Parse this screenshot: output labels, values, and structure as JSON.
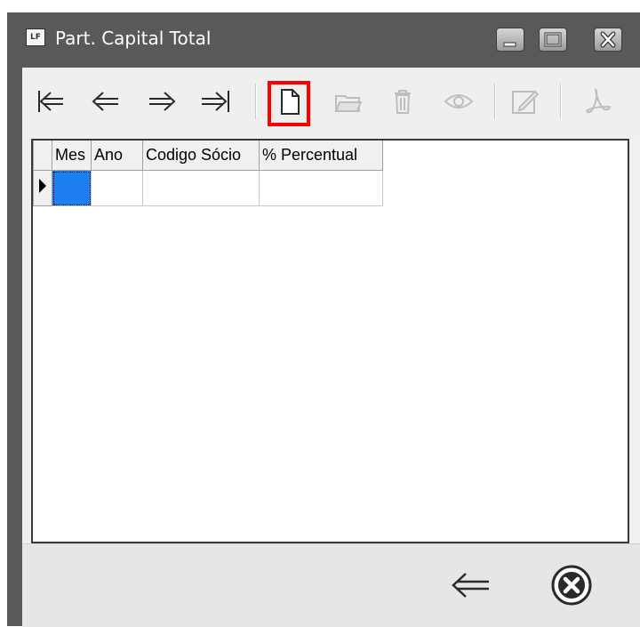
{
  "window": {
    "app_icon_text": "LF",
    "title": "Part. Capital Total"
  },
  "grid": {
    "columns": [
      "Mes",
      "Ano",
      "Codigo Sócio",
      "% Percentual"
    ],
    "rows": [
      [
        "",
        "",
        "",
        ""
      ]
    ]
  },
  "colors": {
    "titlebar": "#595959",
    "client": "#f0f0f0",
    "selection": "#1e7ff0",
    "highlight": "#ff0000"
  },
  "toolbar": {
    "icons": [
      "first-record-icon",
      "previous-record-icon",
      "next-record-icon",
      "last-record-icon",
      "new-record-icon",
      "open-icon",
      "delete-icon",
      "view-icon",
      "edit-icon",
      "pdf-icon"
    ]
  },
  "footer": {
    "icons": [
      "back-arrow-icon",
      "close-circle-icon"
    ]
  }
}
